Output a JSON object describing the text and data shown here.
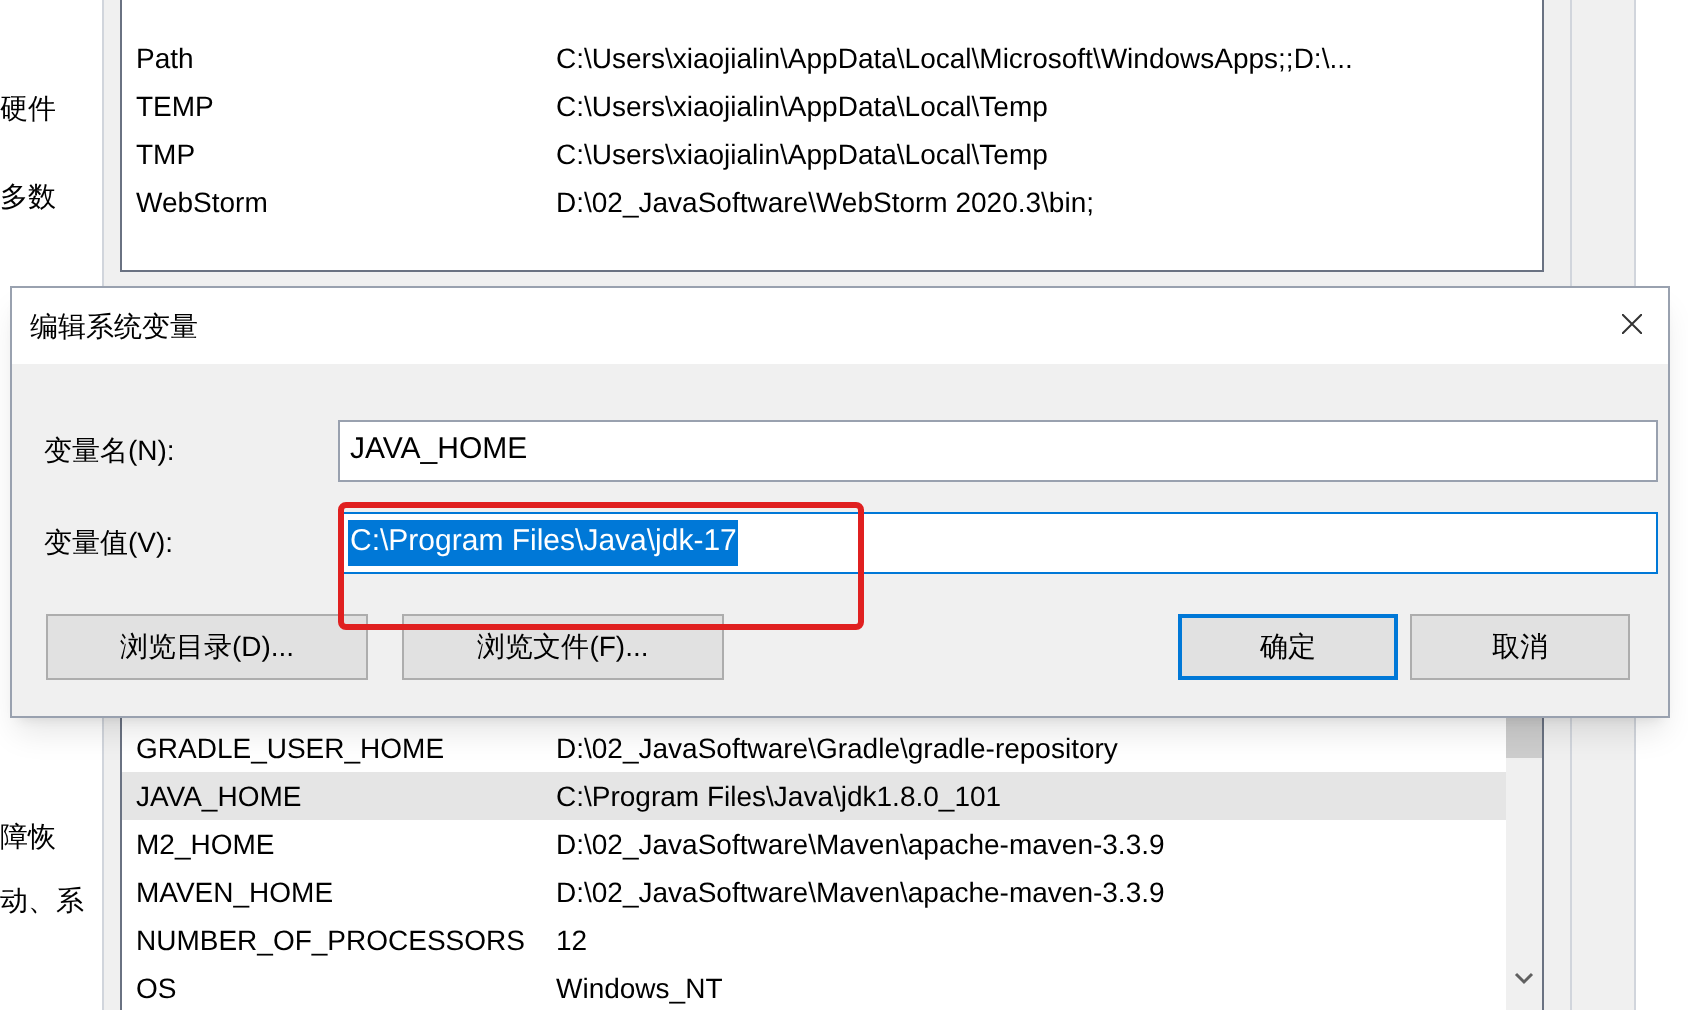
{
  "background_panel": {
    "fragments": [
      {
        "text": "硬件"
      },
      {
        "text": "多数"
      },
      {
        "text": "障恢"
      },
      {
        "text": "动、系"
      }
    ]
  },
  "user_variables": {
    "rows": [
      {
        "name": "Path",
        "value": "C:\\Users\\xiaojialin\\AppData\\Local\\Microsoft\\WindowsApps;;D:\\...",
        "selected": false
      },
      {
        "name": "TEMP",
        "value": "C:\\Users\\xiaojialin\\AppData\\Local\\Temp",
        "selected": false
      },
      {
        "name": "TMP",
        "value": "C:\\Users\\xiaojialin\\AppData\\Local\\Temp",
        "selected": false
      },
      {
        "name": "WebStorm",
        "value": "D:\\02_JavaSoftware\\WebStorm 2020.3\\bin;",
        "selected": false
      }
    ]
  },
  "system_variables": {
    "rows": [
      {
        "name": "GRADLE_USER_HOME",
        "value": "D:\\02_JavaSoftware\\Gradle\\gradle-repository",
        "selected": false
      },
      {
        "name": "JAVA_HOME",
        "value": "C:\\Program Files\\Java\\jdk1.8.0_101",
        "selected": true
      },
      {
        "name": "M2_HOME",
        "value": "D:\\02_JavaSoftware\\Maven\\apache-maven-3.3.9",
        "selected": false
      },
      {
        "name": "MAVEN_HOME",
        "value": "D:\\02_JavaSoftware\\Maven\\apache-maven-3.3.9",
        "selected": false
      },
      {
        "name": "NUMBER_OF_PROCESSORS",
        "value": "12",
        "selected": false
      },
      {
        "name": "OS",
        "value": "Windows_NT",
        "selected": false
      }
    ]
  },
  "dialog": {
    "title": "编辑系统变量",
    "fields": [
      {
        "label": "变量名(N):",
        "value": "JAVA_HOME",
        "focused": false,
        "text_selected": false
      },
      {
        "label": "变量值(V):",
        "value": "C:\\Program Files\\Java\\jdk-17",
        "focused": true,
        "text_selected": true
      }
    ],
    "buttons": [
      {
        "label": "浏览目录(D)...",
        "default": false
      },
      {
        "label": "浏览文件(F)...",
        "default": false
      },
      {
        "label": "确定",
        "default": true
      },
      {
        "label": "取消",
        "default": false
      }
    ]
  }
}
